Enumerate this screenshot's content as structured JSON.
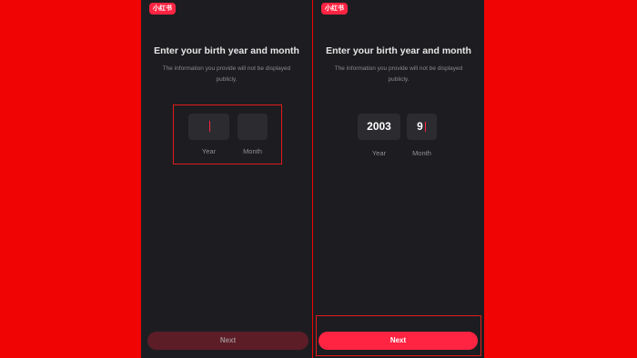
{
  "colors": {
    "background": "#f00404",
    "screen": "#1d1d21",
    "input_box": "#2b2b30",
    "accent": "#ff2442",
    "disabled_button": "#5c1d27",
    "highlight_border": "#e11b1b"
  },
  "screens": [
    {
      "logo": "小红书",
      "title": "Enter your birth year and month",
      "subtitle": "The information you provide will not be displayed publicly.",
      "year_field": {
        "value": "",
        "label": "Year",
        "focused": true
      },
      "month_field": {
        "value": "",
        "label": "Month"
      },
      "next_button": {
        "label": "Next",
        "state": "disabled"
      },
      "highlight": "input-fields"
    },
    {
      "logo": "小红书",
      "title": "Enter your birth year and month",
      "subtitle": "The information you provide will not be displayed publicly.",
      "year_field": {
        "value": "2003",
        "label": "Year"
      },
      "month_field": {
        "value": "9",
        "label": "Month",
        "focused": true
      },
      "next_button": {
        "label": "Next",
        "state": "enabled"
      },
      "highlight": "next-button"
    }
  ]
}
